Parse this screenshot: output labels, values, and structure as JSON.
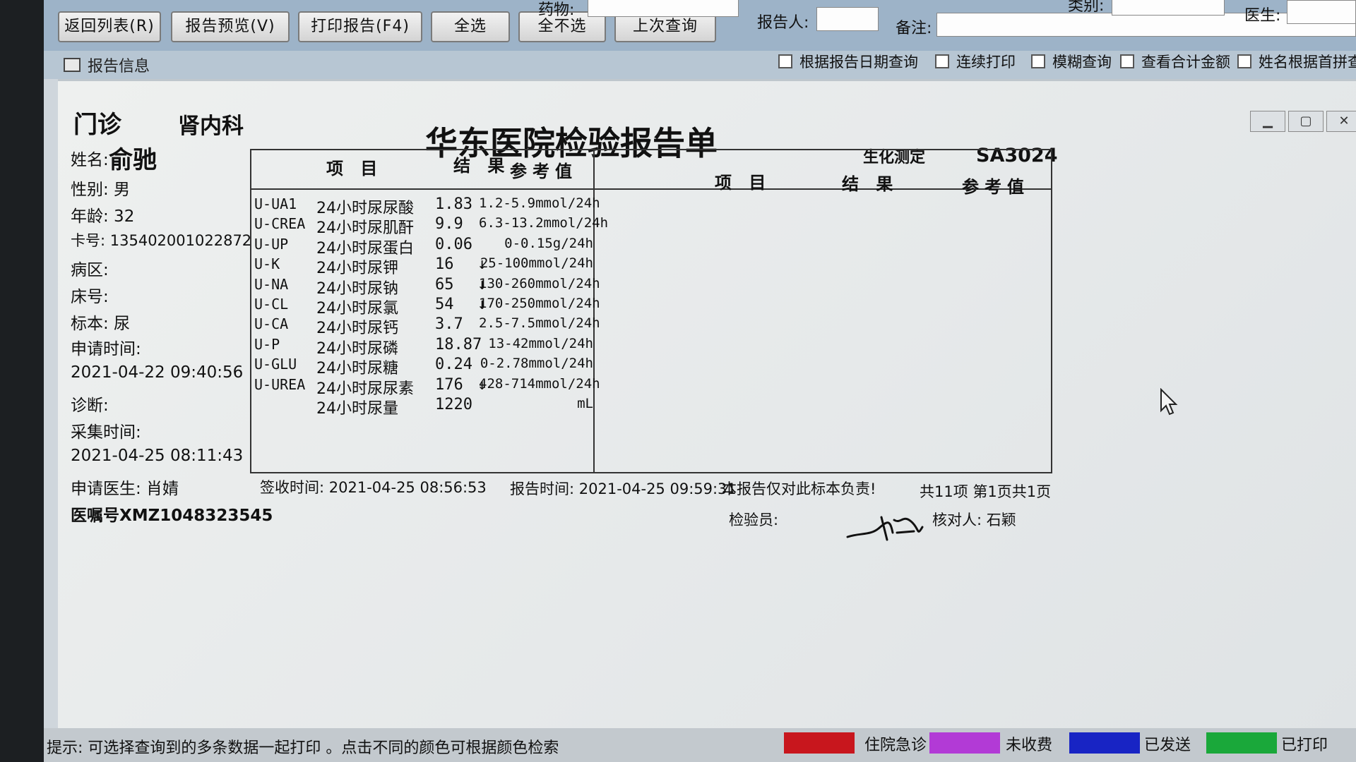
{
  "toolbar": {
    "buttons": [
      {
        "label": "返回列表(R)"
      },
      {
        "label": "报告预览(V)"
      },
      {
        "label": "打印报告(F4)"
      },
      {
        "label": "全选"
      },
      {
        "label": "全不选"
      },
      {
        "label": "上次查询"
      }
    ],
    "fields": {
      "drug": "药物:",
      "reporter": "报告人:",
      "note": "备注:",
      "category": "类别:",
      "doctor": "医生:"
    },
    "checkboxes": [
      {
        "label": "根据报告日期查询"
      },
      {
        "label": "连续打印"
      },
      {
        "label": "模糊查询"
      },
      {
        "label": "查看合计金额"
      },
      {
        "label": "姓名根据首拼查询"
      }
    ]
  },
  "section": {
    "title": "报告信息"
  },
  "report": {
    "type": "门诊",
    "department": "肾内科",
    "title": "华东医院检验报告单",
    "category": "生化测定",
    "sample_id": "SA3024",
    "patient": {
      "name_label": "姓名:",
      "name": "俞驰",
      "sex": "性别: 男",
      "age": "年龄: 32",
      "card": "卡号: 135402001022872",
      "ward": "病区:",
      "bed": "床号:",
      "specimen": "标本: 尿",
      "request_time_label": "申请时间:",
      "request_time": "2021-04-22 09:40:56",
      "diagnosis": "诊断:",
      "collect_time_label": "采集时间:",
      "collect_time": "2021-04-25 08:11:43",
      "request_doctor": "申请医生: 肖婧",
      "order_no": "医嘱号XMZ1048323545"
    },
    "headers": {
      "item": "项 目",
      "result": "结 果",
      "reference": "参考值"
    },
    "rows": [
      {
        "code": "U-UA1",
        "name": "24小时尿尿酸",
        "value": "1.83",
        "flag": "",
        "ref": "1.2-5.9mmol/24h"
      },
      {
        "code": "U-CREA",
        "name": "24小时尿肌酐",
        "value": "9.9",
        "flag": "",
        "ref": "6.3-13.2mmol/24h"
      },
      {
        "code": "U-UP",
        "name": "24小时尿蛋白",
        "value": "0.06",
        "flag": "",
        "ref": "0-0.15g/24h"
      },
      {
        "code": "U-K",
        "name": "24小时尿钾",
        "value": "16",
        "flag": "↓",
        "ref": "25-100mmol/24h"
      },
      {
        "code": "U-NA",
        "name": "24小时尿钠",
        "value": "65",
        "flag": "↓",
        "ref": "130-260mmol/24h"
      },
      {
        "code": "U-CL",
        "name": "24小时尿氯",
        "value": "54",
        "flag": "↓",
        "ref": "170-250mmol/24h"
      },
      {
        "code": "U-CA",
        "name": "24小时尿钙",
        "value": "3.7",
        "flag": "",
        "ref": "2.5-7.5mmol/24h"
      },
      {
        "code": "U-P",
        "name": "24小时尿磷",
        "value": "18.87",
        "flag": "",
        "ref": "13-42mmol/24h"
      },
      {
        "code": "U-GLU",
        "name": "24小时尿糖",
        "value": "0.24",
        "flag": "",
        "ref": "0-2.78mmol/24h"
      },
      {
        "code": "U-UREA",
        "name": "24小时尿尿素",
        "value": "176",
        "flag": "↓",
        "ref": "428-714mmol/24h"
      },
      {
        "code": "",
        "name": "24小时尿量",
        "value": "1220",
        "flag": "",
        "ref": "mL"
      }
    ],
    "footer": {
      "received": "签收时间: 2021-04-25 08:56:53",
      "reported": "报告时间: 2021-04-25 09:59:31",
      "disclaimer": "本报告仅对此标本负责!",
      "pages": "共11项 第1页共1页",
      "inspector_label": "检验员:",
      "checker": "核对人: 石颖"
    }
  },
  "statusbar": {
    "hint": "提示: 可选择查询到的多条数据一起打印 。点击不同的颜色可根据颜色检索",
    "legend": [
      {
        "label": "住院急诊",
        "color": "#c8161d"
      },
      {
        "label": "未收费",
        "color": "#b23ad6"
      },
      {
        "label": "已发送",
        "color": "#1824c4"
      },
      {
        "label": "已打印",
        "color": "#1aa83a"
      }
    ]
  }
}
